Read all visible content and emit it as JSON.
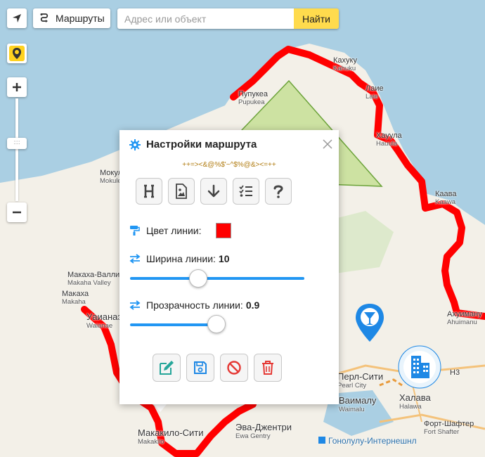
{
  "toolbar": {
    "routes_label": "Маршруты",
    "search_placeholder": "Адрес или объект",
    "search_button": "Найти"
  },
  "map_labels": [
    {
      "ru": "Кахуку",
      "en": "Kahuku"
    },
    {
      "ru": "Пупукеа",
      "en": "Pupukea"
    },
    {
      "ru": "Мокулеиа",
      "en": "Mokuleia"
    },
    {
      "ru": "Лаие",
      "en": "Laie"
    },
    {
      "ru": "Хауула",
      "en": "Hauula"
    },
    {
      "ru": "Каава",
      "en": "Kaawa"
    },
    {
      "ru": "Макаха-Валли",
      "en": "Makaha Valley"
    },
    {
      "ru": "Макаха",
      "en": "Makaha"
    },
    {
      "ru": "Уаианаэ",
      "en": "Waianae"
    },
    {
      "ru": "Ахуиману",
      "en": "Ahuimanu"
    },
    {
      "ru": "Перл-Сити",
      "en": "Pearl City"
    },
    {
      "ru": "Ваималу",
      "en": "Waimalu"
    },
    {
      "ru": "Халава",
      "en": "Halawa"
    },
    {
      "ru": "Форт-Шафтер",
      "en": "Fort Shafter"
    },
    {
      "ru": "Эва-Джентри",
      "en": "Ewa Gentry"
    },
    {
      "ru": "Макакило-Сити",
      "en": "Makakilo"
    },
    {
      "ru": "Гонолулу-Интернешнл",
      "en": ""
    },
    {
      "ru": "H3",
      "en": ""
    }
  ],
  "popup": {
    "title": "Настройки маршрута",
    "subtitle": "++=><&@%$'~^$%@&><=++",
    "color_label": "Цвет линии:",
    "line_color": "#ff0000",
    "width_label": "Ширина линии:",
    "width_value": "10",
    "width_slider_fraction": 0.39,
    "opacity_label": "Прозрачность линии:",
    "opacity_value": "0.9",
    "opacity_slider_fraction": 0.9,
    "tool_icons": [
      "heading-icon",
      "image-file-icon",
      "arrow-down-icon",
      "checklist-icon",
      "question-icon"
    ],
    "action_icons": [
      "edit-icon",
      "save-icon",
      "cancel-icon",
      "delete-icon"
    ]
  },
  "colors": {
    "route": "#ff0000",
    "accent": "#2196f3",
    "search_button": "#ffdb4d"
  }
}
